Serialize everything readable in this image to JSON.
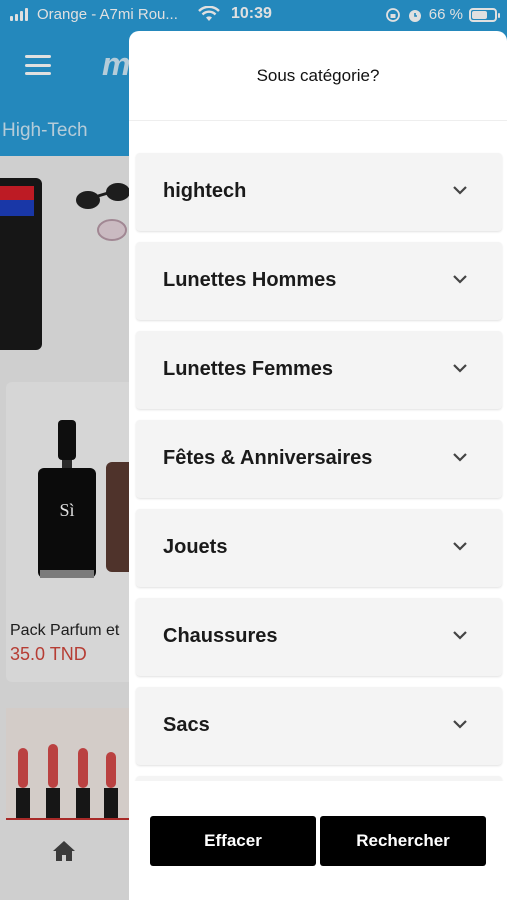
{
  "status_bar": {
    "carrier": "Orange - A7mi Rou...",
    "time": "10:39",
    "battery": "66 %",
    "battery_level": 0.66
  },
  "app": {
    "logo": "m",
    "category_tab": "High-Tech",
    "product": {
      "name": "Pack Parfum et",
      "price": "35.0 TND"
    }
  },
  "drawer": {
    "title": "Sous catégorie?",
    "items": [
      {
        "label": "hightech"
      },
      {
        "label": "Lunettes Hommes"
      },
      {
        "label": "Lunettes Femmes"
      },
      {
        "label": "Fêtes & Anniversaires"
      },
      {
        "label": "Jouets"
      },
      {
        "label": "Chaussures"
      },
      {
        "label": "Sacs"
      }
    ],
    "clear_label": "Effacer",
    "search_label": "Rechercher"
  },
  "colors": {
    "brand": "#2a9bd6",
    "price": "#d0463c",
    "button": "#000000"
  }
}
